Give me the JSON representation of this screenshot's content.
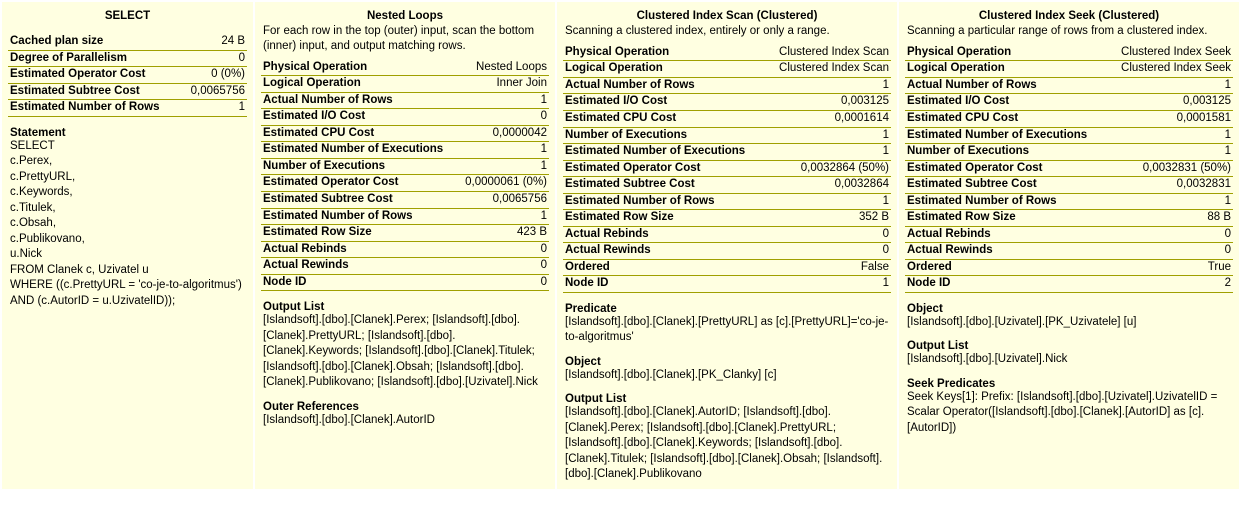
{
  "panel1": {
    "title": "SELECT",
    "props": [
      {
        "label": "Cached plan size",
        "value": "24 B"
      },
      {
        "label": "Degree of Parallelism",
        "value": "0"
      },
      {
        "label": "Estimated Operator Cost",
        "value": "0 (0%)"
      },
      {
        "label": "Estimated Subtree Cost",
        "value": "0,0065756"
      },
      {
        "label": "Estimated Number of Rows",
        "value": "1"
      }
    ],
    "statement_hdr": "Statement",
    "statement": "SELECT\nc.Perex,\nc.PrettyURL,\nc.Keywords,\nc.Titulek,\nc.Obsah,\nc.Publikovano,\nu.Nick\nFROM Clanek c, Uzivatel u\nWHERE ((c.PrettyURL = 'co-je-to-algoritmus')\nAND (c.AutorID = u.UzivatelID));"
  },
  "panel2": {
    "title": "Nested Loops",
    "desc": "For each row in the top (outer) input, scan the bottom (inner) input, and output matching rows.",
    "props": [
      {
        "label": "Physical Operation",
        "value": "Nested Loops"
      },
      {
        "label": "Logical Operation",
        "value": "Inner Join"
      },
      {
        "label": "Actual Number of Rows",
        "value": "1"
      },
      {
        "label": "Estimated I/O Cost",
        "value": "0"
      },
      {
        "label": "Estimated CPU Cost",
        "value": "0,0000042"
      },
      {
        "label": "Estimated Number of Executions",
        "value": "1"
      },
      {
        "label": "Number of Executions",
        "value": "1"
      },
      {
        "label": "Estimated Operator Cost",
        "value": "0,0000061 (0%)"
      },
      {
        "label": "Estimated Subtree Cost",
        "value": "0,0065756"
      },
      {
        "label": "Estimated Number of Rows",
        "value": "1"
      },
      {
        "label": "Estimated Row Size",
        "value": "423 B"
      },
      {
        "label": "Actual Rebinds",
        "value": "0"
      },
      {
        "label": "Actual Rewinds",
        "value": "0"
      },
      {
        "label": "Node ID",
        "value": "0"
      }
    ],
    "output_hdr": "Output List",
    "output": "[Islandsoft].[dbo].[Clanek].Perex; [Islandsoft].[dbo].[Clanek].PrettyURL; [Islandsoft].[dbo].[Clanek].Keywords; [Islandsoft].[dbo].[Clanek].Titulek; [Islandsoft].[dbo].[Clanek].Obsah; [Islandsoft].[dbo].[Clanek].Publikovano; [Islandsoft].[dbo].[Uzivatel].Nick",
    "outer_hdr": "Outer References",
    "outer": "[Islandsoft].[dbo].[Clanek].AutorID"
  },
  "panel3": {
    "title": "Clustered Index Scan (Clustered)",
    "desc": "Scanning a clustered index, entirely or only a range.",
    "props": [
      {
        "label": "Physical Operation",
        "value": "Clustered Index Scan"
      },
      {
        "label": "Logical Operation",
        "value": "Clustered Index Scan"
      },
      {
        "label": "Actual Number of Rows",
        "value": "1"
      },
      {
        "label": "Estimated I/O Cost",
        "value": "0,003125"
      },
      {
        "label": "Estimated CPU Cost",
        "value": "0,0001614"
      },
      {
        "label": "Number of Executions",
        "value": "1"
      },
      {
        "label": "Estimated Number of Executions",
        "value": "1"
      },
      {
        "label": "Estimated Operator Cost",
        "value": "0,0032864 (50%)"
      },
      {
        "label": "Estimated Subtree Cost",
        "value": "0,0032864"
      },
      {
        "label": "Estimated Number of Rows",
        "value": "1"
      },
      {
        "label": "Estimated Row Size",
        "value": "352 B"
      },
      {
        "label": "Actual Rebinds",
        "value": "0"
      },
      {
        "label": "Actual Rewinds",
        "value": "0"
      },
      {
        "label": "Ordered",
        "value": "False"
      },
      {
        "label": "Node ID",
        "value": "1"
      }
    ],
    "predicate_hdr": "Predicate",
    "predicate": "[Islandsoft].[dbo].[Clanek].[PrettyURL] as [c].[PrettyURL]='co-je-to-algoritmus'",
    "object_hdr": "Object",
    "object": "[Islandsoft].[dbo].[Clanek].[PK_Clanky] [c]",
    "output_hdr": "Output List",
    "output": "[Islandsoft].[dbo].[Clanek].AutorID; [Islandsoft].[dbo].[Clanek].Perex; [Islandsoft].[dbo].[Clanek].PrettyURL; [Islandsoft].[dbo].[Clanek].Keywords; [Islandsoft].[dbo].[Clanek].Titulek; [Islandsoft].[dbo].[Clanek].Obsah; [Islandsoft].[dbo].[Clanek].Publikovano"
  },
  "panel4": {
    "title": "Clustered Index Seek (Clustered)",
    "desc": "Scanning a particular range of rows from a clustered index.",
    "props": [
      {
        "label": "Physical Operation",
        "value": "Clustered Index Seek"
      },
      {
        "label": "Logical Operation",
        "value": "Clustered Index Seek"
      },
      {
        "label": "Actual Number of Rows",
        "value": "1"
      },
      {
        "label": "Estimated I/O Cost",
        "value": "0,003125"
      },
      {
        "label": "Estimated CPU Cost",
        "value": "0,0001581"
      },
      {
        "label": "Estimated Number of Executions",
        "value": "1"
      },
      {
        "label": "Number of Executions",
        "value": "1"
      },
      {
        "label": "Estimated Operator Cost",
        "value": "0,0032831 (50%)"
      },
      {
        "label": "Estimated Subtree Cost",
        "value": "0,0032831"
      },
      {
        "label": "Estimated Number of Rows",
        "value": "1"
      },
      {
        "label": "Estimated Row Size",
        "value": "88 B"
      },
      {
        "label": "Actual Rebinds",
        "value": "0"
      },
      {
        "label": "Actual Rewinds",
        "value": "0"
      },
      {
        "label": "Ordered",
        "value": "True"
      },
      {
        "label": "Node ID",
        "value": "2"
      }
    ],
    "object_hdr": "Object",
    "object": "[Islandsoft].[dbo].[Uzivatel].[PK_Uzivatele] [u]",
    "output_hdr": "Output List",
    "output": "[Islandsoft].[dbo].[Uzivatel].Nick",
    "seek_hdr": "Seek Predicates",
    "seek": "Seek Keys[1]: Prefix: [Islandsoft].[dbo].[Uzivatel].UzivatelID = Scalar Operator([Islandsoft].[dbo].[Clanek].[AutorID] as [c].[AutorID])"
  }
}
